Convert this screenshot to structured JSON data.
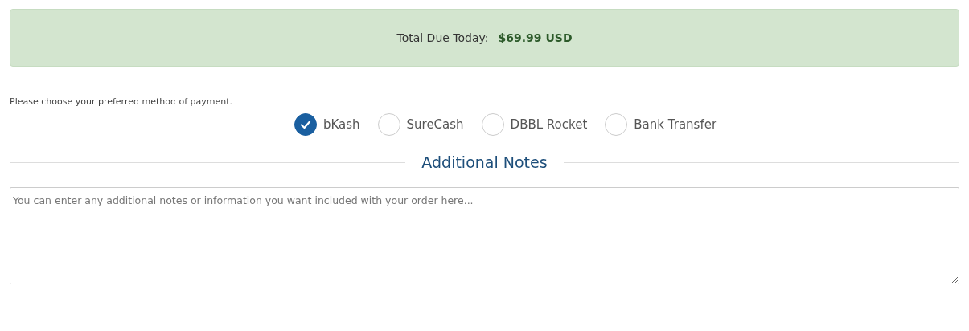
{
  "total_due": {
    "label": "Total Due Today:",
    "amount": "$69.99 USD"
  },
  "payment": {
    "prompt": "Please choose your preferred method of payment.",
    "methods": [
      {
        "label": "bKash",
        "selected": true
      },
      {
        "label": "SureCash",
        "selected": false
      },
      {
        "label": "DBBL Rocket",
        "selected": false
      },
      {
        "label": "Bank Transfer",
        "selected": false
      }
    ]
  },
  "notes": {
    "heading": "Additional Notes",
    "placeholder": "You can enter any additional notes or information you want included with your order here..."
  }
}
